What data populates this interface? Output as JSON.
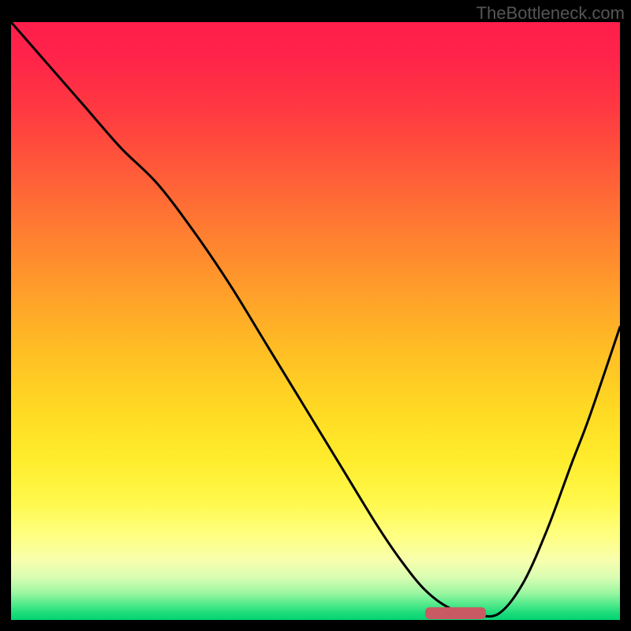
{
  "watermark": "TheBottleneck.com",
  "chart_data": {
    "type": "line",
    "title": "",
    "xlabel": "",
    "ylabel": "",
    "xlim": [
      0,
      100
    ],
    "ylim": [
      0,
      100
    ],
    "series": [
      {
        "name": "curve",
        "x": [
          0,
          6,
          12,
          18,
          24,
          30,
          36,
          42,
          48,
          54,
          60,
          64,
          68,
          72,
          76,
          80,
          84,
          88,
          92,
          95,
          100
        ],
        "y": [
          100,
          93,
          86,
          79,
          73,
          65,
          56,
          46,
          36,
          26,
          16,
          10,
          5,
          2,
          1,
          1,
          6,
          15,
          26,
          34,
          49
        ]
      }
    ],
    "marker_bar": {
      "x_start": 68,
      "x_end": 78,
      "thickness": 2.0,
      "color": "#c95a63"
    },
    "background_gradient": {
      "stops": [
        {
          "offset": 0.0,
          "color": "#ff1e4b"
        },
        {
          "offset": 0.06,
          "color": "#ff2449"
        },
        {
          "offset": 0.15,
          "color": "#ff3a41"
        },
        {
          "offset": 0.25,
          "color": "#ff5b39"
        },
        {
          "offset": 0.35,
          "color": "#ff7d31"
        },
        {
          "offset": 0.45,
          "color": "#ff9e2a"
        },
        {
          "offset": 0.55,
          "color": "#ffbe24"
        },
        {
          "offset": 0.65,
          "color": "#ffda23"
        },
        {
          "offset": 0.73,
          "color": "#ffec2c"
        },
        {
          "offset": 0.8,
          "color": "#fff84a"
        },
        {
          "offset": 0.86,
          "color": "#ffff82"
        },
        {
          "offset": 0.9,
          "color": "#f8ffad"
        },
        {
          "offset": 0.93,
          "color": "#d7fdb2"
        },
        {
          "offset": 0.955,
          "color": "#9af6a0"
        },
        {
          "offset": 0.975,
          "color": "#4de98a"
        },
        {
          "offset": 0.99,
          "color": "#17db79"
        },
        {
          "offset": 1.0,
          "color": "#07d373"
        }
      ]
    },
    "curve_stroke": "#000000",
    "curve_width": 3
  }
}
